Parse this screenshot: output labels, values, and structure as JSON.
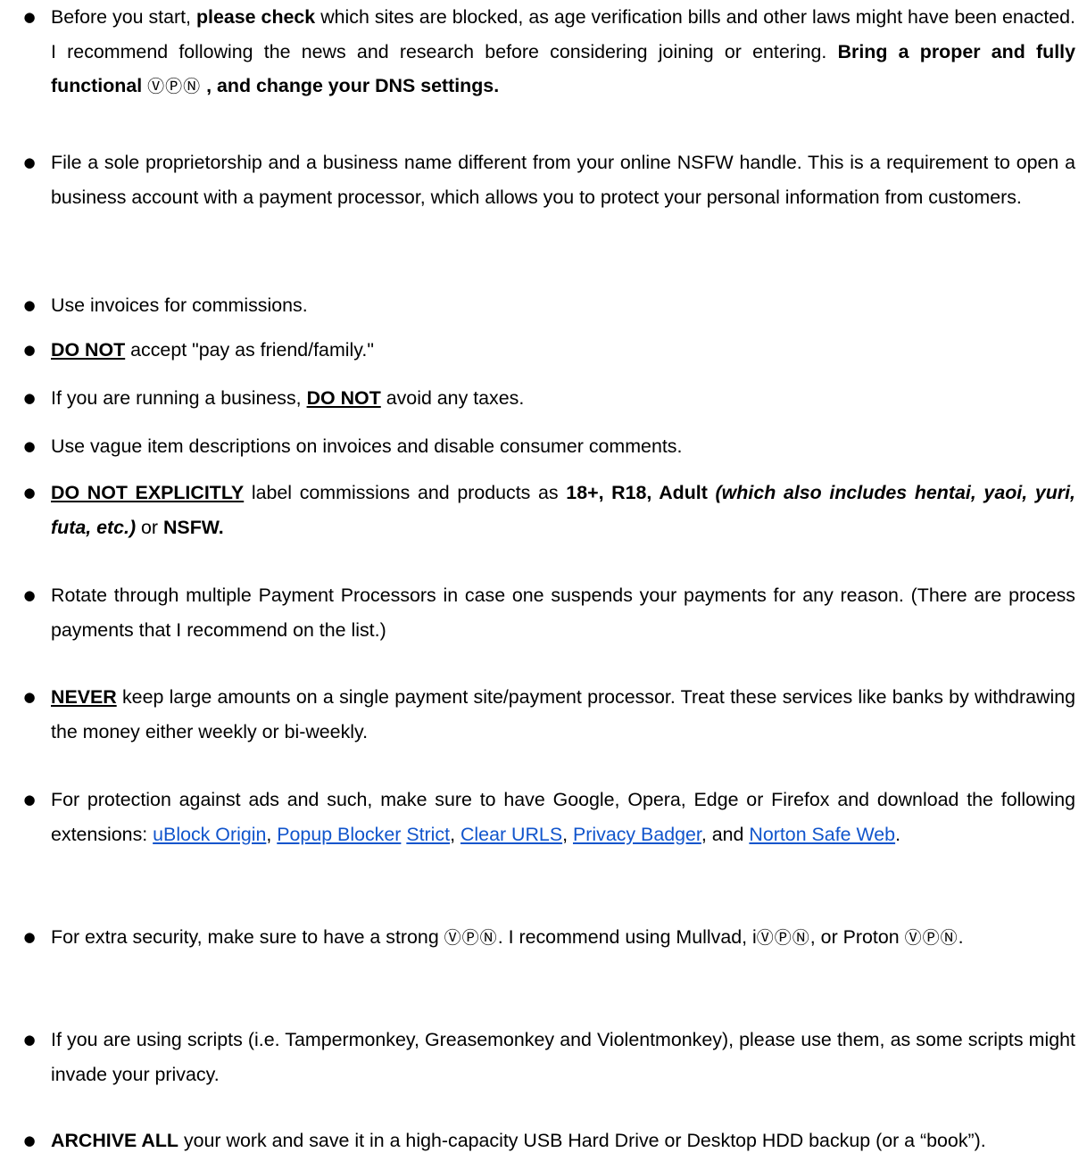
{
  "items": [
    {
      "segments": [
        {
          "t": "Before you start, "
        },
        {
          "t": "please check",
          "b": true
        },
        {
          "t": " which sites are blocked, as age verification bills and other laws might have been enacted. I recommend following the news and research before considering joining or entering. "
        },
        {
          "t": "Bring a proper and fully functional ",
          "b": true
        },
        {
          "t": "ⓋⓅⓃ",
          "vpn": true
        },
        {
          "t": " , and change your DNS settings.",
          "b": true
        }
      ]
    },
    {
      "segments": [
        {
          "t": "File a sole proprietorship and a business name different from your online NSFW handle. This is a requirement to open a business account with a payment processor, which allows you to protect your personal information from customers."
        }
      ]
    },
    {
      "segments": [
        {
          "t": "Use invoices for commissions."
        }
      ]
    },
    {
      "segments": [
        {
          "t": "DO NOT",
          "b": true,
          "u": true
        },
        {
          "t": " accept \"pay as friend/family.\""
        }
      ]
    },
    {
      "segments": [
        {
          "t": "If you are running a business, "
        },
        {
          "t": "DO NOT",
          "b": true,
          "u": true
        },
        {
          "t": " avoid any taxes."
        }
      ]
    },
    {
      "segments": [
        {
          "t": "Use vague item descriptions on invoices and disable consumer comments."
        }
      ]
    },
    {
      "segments": [
        {
          "t": "DO NOT EXPLICITLY",
          "b": true,
          "u": true
        },
        {
          "t": " label commissions and products as "
        },
        {
          "t": "18+, R18, Adult ",
          "b": true
        },
        {
          "t": "(which also includes hentai, yaoi, yuri, futa, etc.)",
          "b": true,
          "i": true
        },
        {
          "t": " or "
        },
        {
          "t": "NSFW.",
          "b": true
        }
      ]
    },
    {
      "segments": [
        {
          "t": "Rotate through multiple Payment Processors in case one suspends your payments for any reason. (There are process payments that I recommend on the list.)"
        }
      ]
    },
    {
      "segments": [
        {
          "t": "NEVER",
          "b": true,
          "u": true
        },
        {
          "t": " keep large amounts on a single payment site/payment processor. Treat these services like banks by withdrawing the money either weekly or bi-weekly."
        }
      ]
    },
    {
      "segments": [
        {
          "t": "For protection against ads and such, make sure to have Google, Opera, Edge or Firefox and download the following extensions: "
        },
        {
          "t": "uBlock Origin",
          "link": true,
          "name": "link-ublock-origin"
        },
        {
          "t": ", "
        },
        {
          "t": "Popup Blocker",
          "link": true,
          "name": "link-popup-blocker"
        },
        {
          "t": " "
        },
        {
          "t": "Strict",
          "link": true,
          "name": "link-strict"
        },
        {
          "t": ", "
        },
        {
          "t": "Clear URLS",
          "link": true,
          "name": "link-clear-urls"
        },
        {
          "t": ", "
        },
        {
          "t": "Privacy Badger",
          "link": true,
          "name": "link-privacy-badger"
        },
        {
          "t": ", and "
        },
        {
          "t": "Norton Safe Web",
          "link": true,
          "name": "link-norton-safe-web"
        },
        {
          "t": "."
        }
      ]
    },
    {
      "segments": [
        {
          "t": "For extra security, make sure to have a strong "
        },
        {
          "t": "ⓋⓅⓃ",
          "vpn": true
        },
        {
          "t": ". I recommend using Mullvad, i"
        },
        {
          "t": "ⓋⓅⓃ",
          "vpn": true
        },
        {
          "t": ", or Proton "
        },
        {
          "t": "ⓋⓅⓃ",
          "vpn": true
        },
        {
          "t": "."
        }
      ]
    },
    {
      "segments": [
        {
          "t": "If you are using scripts (i.e. Tampermonkey, Greasemonkey and Violentmonkey), please use them, as some scripts might invade your privacy."
        }
      ]
    },
    {
      "segments": [
        {
          "t": "ARCHIVE ALL",
          "b": true
        },
        {
          "t": " your work and save it in a high-capacity USB Hard Drive or Desktop HDD backup (or a “book”)."
        }
      ]
    }
  ],
  "bullet_glyph": "●",
  "link_color": "#1155cc"
}
